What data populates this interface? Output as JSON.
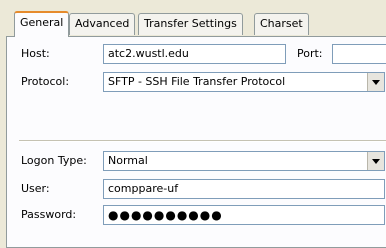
{
  "tabs": [
    {
      "label": "General",
      "active": true
    },
    {
      "label": "Advanced",
      "active": false
    },
    {
      "label": "Transfer Settings",
      "active": false
    },
    {
      "label": "Charset",
      "active": false
    }
  ],
  "general": {
    "host_label": "Host:",
    "host_value": "atc2.wustl.edu",
    "port_label": "Port:",
    "port_value": "",
    "protocol_label": "Protocol:",
    "protocol_value": "SFTP - SSH File Transfer Protocol",
    "logon_type_label": "Logon Type:",
    "logon_type_value": "Normal",
    "user_label": "User:",
    "user_value": "comppare-uf",
    "password_label": "Password:",
    "password_value": "●●●●●●●●●●"
  }
}
